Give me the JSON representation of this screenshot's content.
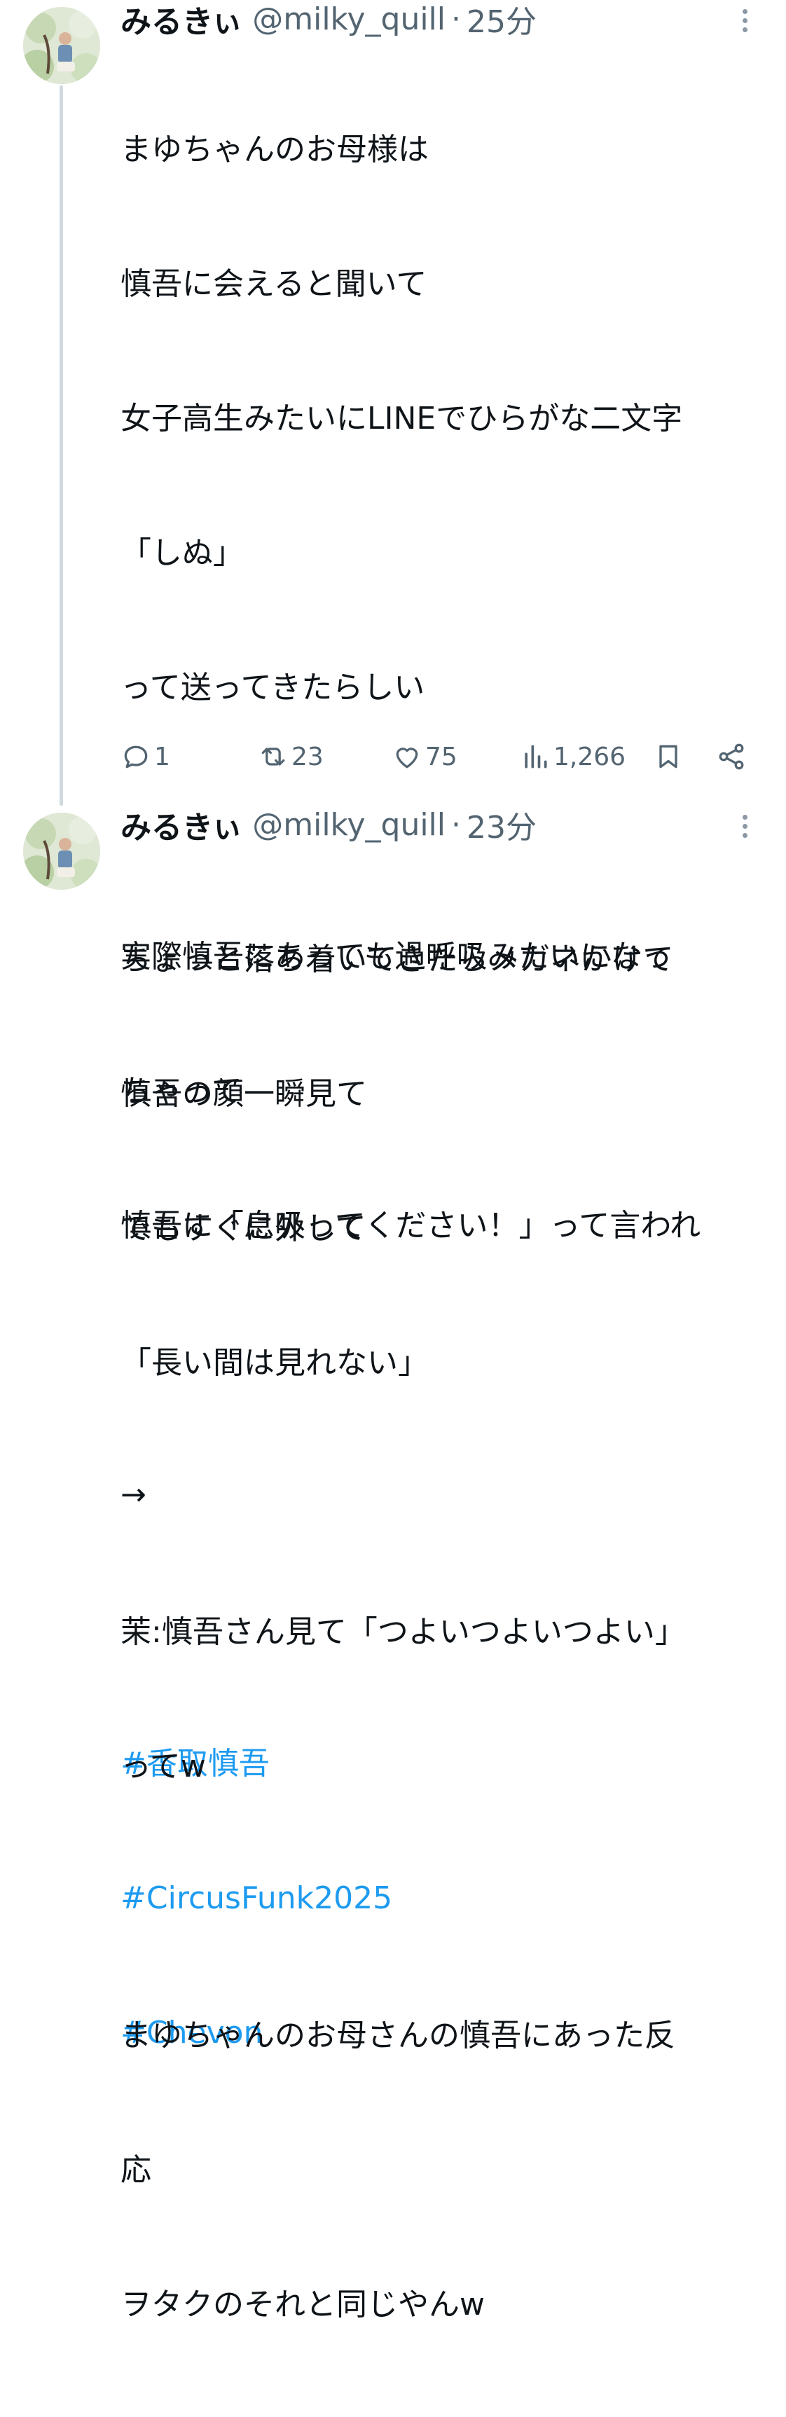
{
  "posts": [
    {
      "display_name": "みるきぃ",
      "handle": "@milky_quill",
      "separator": "·",
      "time": "25分",
      "lines": [
        "まゆちゃんのお母様は",
        "慎吾に会えると聞いて",
        "女子高生みたいにLINEでひらがな二文字",
        "「しぬ」",
        "って送ってきたらしい",
        "",
        "実際慎吾にあっても過呼吸みたいになっ",
        "ちゃって",
        "慎吾に「息吸ってください！」って言われ",
        "",
        "→",
        ""
      ],
      "hashtags": [
        "#香取慎吾",
        "#CircusFunk2025",
        "#Chevon"
      ],
      "actions": {
        "replies": "1",
        "reposts": "23",
        "likes": "75",
        "views": "1,266"
      }
    },
    {
      "display_name": "みるきぃ",
      "handle": "@milky_quill",
      "separator": "·",
      "time": "23分",
      "lines": [
        "ちょっと落ち着いてきたらメガネかけて",
        "慎吾の顔一瞬見て",
        "でもすぐに外して",
        "「長い間は見れない」",
        "",
        "茉:慎吾さん見て「つよいつよいつよい」",
        "ってw",
        "",
        "まゆちゃんのお母さんの慎吾にあった反",
        "応",
        "ヲタクのそれと同じやんw"
      ]
    }
  ],
  "icons": {
    "more": "more-vertical-icon",
    "reply": "reply-icon",
    "repost": "repost-icon",
    "like": "heart-icon",
    "views": "views-chart-icon",
    "bookmark": "bookmark-icon",
    "share": "share-icon"
  },
  "colors": {
    "text": "#0f1419",
    "secondary": "#536471",
    "hashtag": "#1d9bf0",
    "thread_line": "#cfd9de"
  }
}
